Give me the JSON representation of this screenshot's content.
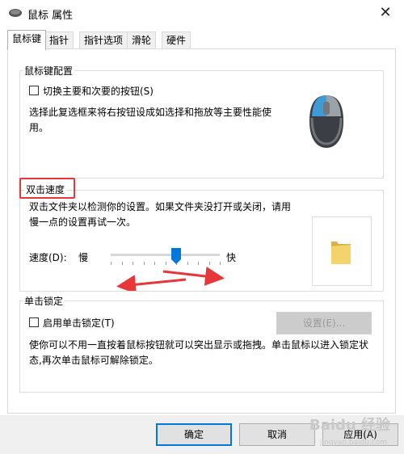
{
  "window": {
    "title": "鼠标 属性",
    "close_glyph": "✕"
  },
  "tabs": [
    {
      "label": "鼠标键",
      "active": true
    },
    {
      "label": "指针",
      "active": false
    },
    {
      "label": "指针选项",
      "active": false
    },
    {
      "label": "滑轮",
      "active": false
    },
    {
      "label": "硬件",
      "active": false
    }
  ],
  "button_config": {
    "title": "鼠标键配置",
    "checkbox_label": "切换主要和次要的按钮(S)",
    "checked": false,
    "description": "选择此复选框来将右按钮设成如选择和拖放等主要性能使用。"
  },
  "double_click": {
    "title": "双击速度",
    "description": "双击文件夹以检测你的设置。如果文件夹没打开或关闭，请用慢一点的设置再试一次。",
    "speed_label": "速度(D):",
    "slow_label": "慢",
    "fast_label": "快",
    "slider_value_fraction": 0.6
  },
  "click_lock": {
    "title": "单击锁定",
    "checkbox_label": "启用单击锁定(T)",
    "checked": false,
    "settings_button": "设置(E)...",
    "description": "使你可以不用一直按着鼠标按钮就可以突出显示或拖拽。单击鼠标以进入锁定状态,再次单击鼠标可解除锁定。"
  },
  "footer": {
    "ok": "确定",
    "cancel": "取消",
    "apply": "应用(A)"
  },
  "watermark": {
    "text": "Baidu 经验",
    "url": "jingyan.baidu.com"
  },
  "colors": {
    "accent": "#0078d7",
    "annotation_red": "#e8373a",
    "folder": "#f3d36b"
  }
}
